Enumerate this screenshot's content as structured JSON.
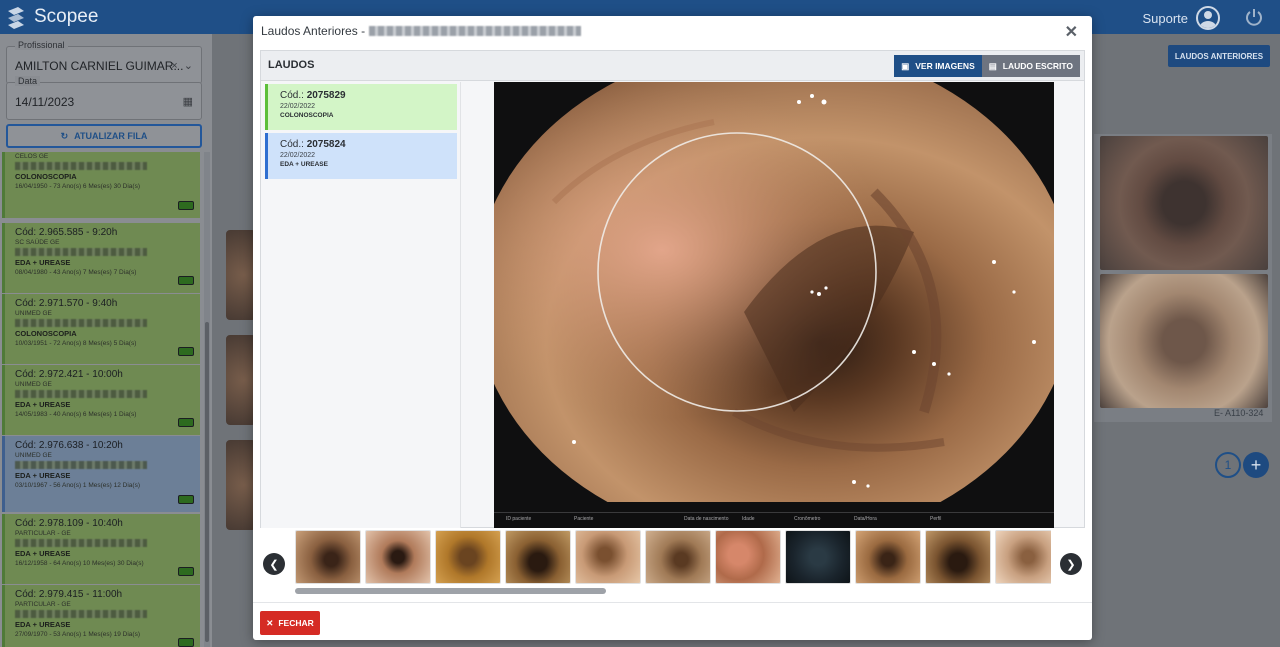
{
  "app": {
    "brand": "Scopee",
    "support_label": "Suporte"
  },
  "sidebar": {
    "professional": {
      "label": "Profissional",
      "value": "AMILTON CARNIEL GUIMAR..."
    },
    "date": {
      "label": "Data",
      "value": "14/11/2023"
    },
    "refresh_label": "ATUALIZAR FILA",
    "queue": [
      {
        "code": "",
        "insurance": "CELOS GE",
        "exam": "COLONOSCOPIA",
        "age": "16/04/1950 - 73 Ano(s) 6 Mes(es) 30 Dia(s)"
      },
      {
        "code": "Cód: 2.965.585 - 9:20h",
        "insurance": "SC SAÚDE GE",
        "exam": "EDA + UREASE",
        "age": "08/04/1980 - 43 Ano(s) 7 Mes(es) 7 Dia(s)"
      },
      {
        "code": "Cód: 2.971.570 - 9:40h",
        "insurance": "UNIMED GE",
        "exam": "COLONOSCOPIA",
        "age": "10/03/1951 - 72 Ano(s) 8 Mes(es) 5 Dia(s)"
      },
      {
        "code": "Cód: 2.972.421 - 10:00h",
        "insurance": "UNIMED GE",
        "exam": "EDA + UREASE",
        "age": "14/05/1983 - 40 Ano(s) 6 Mes(es) 1 Dia(s)"
      },
      {
        "code": "Cód: 2.976.638 - 10:20h",
        "insurance": "UNIMED GE",
        "exam": "EDA + UREASE",
        "age": "03/10/1967 - 56 Ano(s) 1 Mes(es) 12 Dia(s)"
      },
      {
        "code": "Cód: 2.978.109 - 10:40h",
        "insurance": "PARTICULAR - GE",
        "exam": "EDA + UREASE",
        "age": "16/12/1958 - 64 Ano(s) 10 Mes(es) 30 Dia(s)"
      },
      {
        "code": "Cód: 2.979.415 - 11:00h",
        "insurance": "PARTICULAR - GE",
        "exam": "EDA + UREASE",
        "age": "27/09/1970 - 53 Ano(s) 1 Mes(es) 19 Dia(s)"
      }
    ]
  },
  "background": {
    "laudos_anteriores_label": "LAUDOS ANTERIORES",
    "image_code": "E- A110-324",
    "page": "1",
    "add_label": "+"
  },
  "modal": {
    "title": "Laudos Anteriores - ",
    "panel_title": "LAUDOS",
    "tab_images": "VER IMAGENS",
    "tab_written": "LAUDO ESCRITO",
    "reports": [
      {
        "code_prefix": "Cód.: ",
        "code": "2075829",
        "date": "22/02/2022",
        "exam": "COLONOSCOPIA"
      },
      {
        "code_prefix": "Cód.: ",
        "code": "2075824",
        "date": "22/02/2022",
        "exam": "EDA + UREASE"
      }
    ],
    "viewer_footer": [
      "ID paciente",
      "Paciente",
      "Data de nascimento",
      "Idade",
      "Cronômetro",
      "Data/Hora",
      "Perfil"
    ],
    "close_label": "FECHAR"
  }
}
